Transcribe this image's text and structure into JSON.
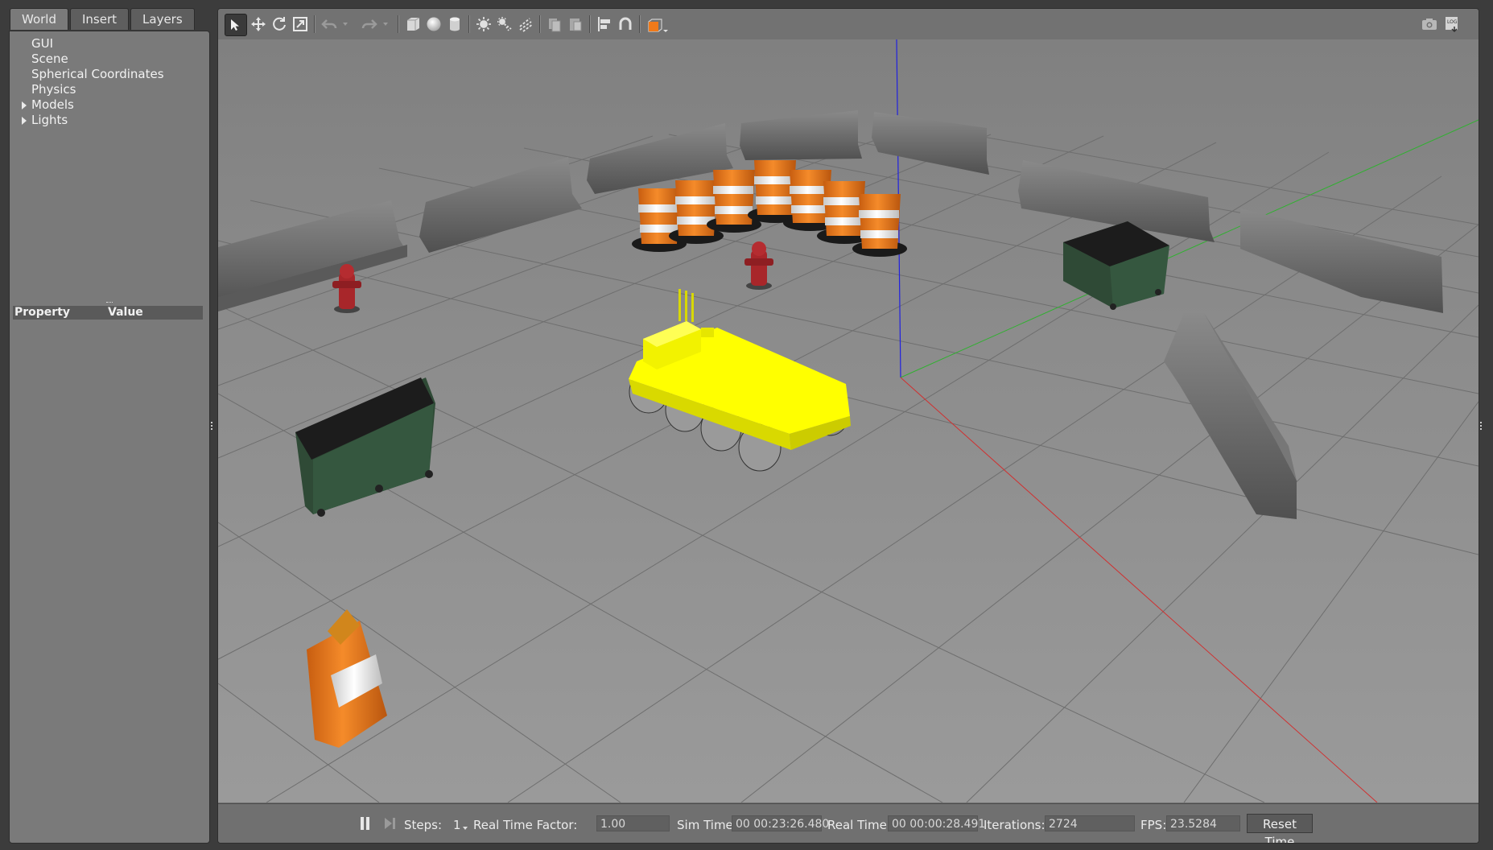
{
  "left_panel": {
    "tabs": [
      {
        "label": "World",
        "active": true
      },
      {
        "label": "Insert",
        "active": false
      },
      {
        "label": "Layers",
        "active": false
      }
    ],
    "tree": [
      {
        "label": "GUI",
        "expandable": false
      },
      {
        "label": "Scene",
        "expandable": false
      },
      {
        "label": "Spherical Coordinates",
        "expandable": false
      },
      {
        "label": "Physics",
        "expandable": false
      },
      {
        "label": "Models",
        "expandable": true
      },
      {
        "label": "Lights",
        "expandable": true
      }
    ],
    "properties": {
      "col_property": "Property",
      "col_value": "Value"
    }
  },
  "toolbar": {
    "tools": [
      "select-mode-icon",
      "translate-mode-icon",
      "rotate-mode-icon",
      "scale-mode-icon",
      "undo-icon",
      "undo-history-icon",
      "redo-icon",
      "redo-history-icon",
      "box-shape-icon",
      "sphere-shape-icon",
      "cylinder-shape-icon",
      "point-light-icon",
      "spot-light-icon",
      "directional-light-icon",
      "copy-icon",
      "paste-icon",
      "align-icon",
      "snap-icon",
      "view-angle-icon",
      "screenshot-icon",
      "log-icon"
    ],
    "active_tool": "select-mode-icon"
  },
  "bottom_bar": {
    "steps_label": "Steps:",
    "steps_value": "1",
    "rtf_label": "Real Time Factor:",
    "rtf_value": "1.00",
    "sim_time_label": "Sim Time:",
    "sim_time_value": "00 00:23:26.480",
    "real_time_label": "Real Time:",
    "real_time_value": "00 00:00:28.491",
    "iterations_label": "Iterations:",
    "iterations_value": "2724",
    "fps_label": "FPS:",
    "fps_value": "23.5284",
    "reset_label": "Reset Time"
  },
  "colors": {
    "robot": "#ffff00",
    "cone_orange": "#f07a1a",
    "axis_x": "#d03030",
    "axis_y": "#30b030",
    "axis_z": "#2020e0",
    "barrier": "#6a6a6a",
    "dumpster": "#2f4a36",
    "hydrant": "#a8262a"
  }
}
